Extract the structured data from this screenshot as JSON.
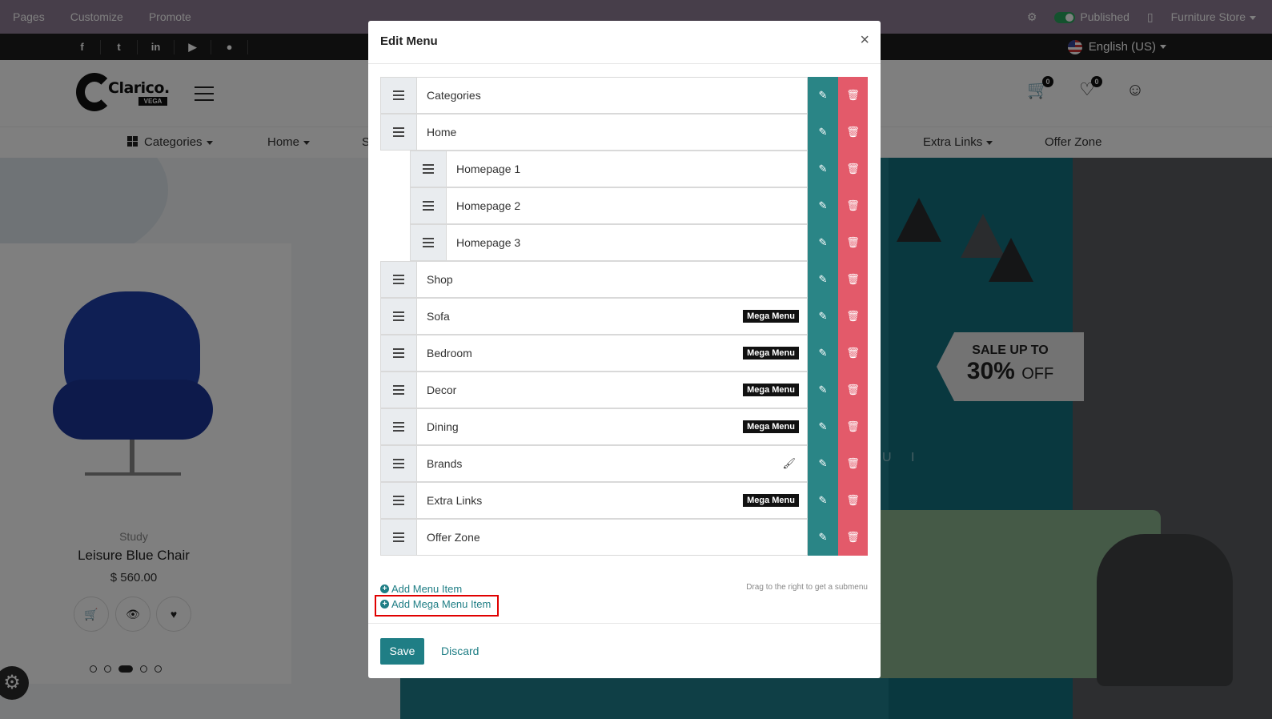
{
  "editor_bar": {
    "nav": [
      "Pages",
      "Customize",
      "Promote"
    ],
    "published_label": "Published",
    "website_label": "Furniture Store"
  },
  "social": {
    "icons": [
      "f",
      "t",
      "in",
      "▶",
      "●"
    ],
    "language": "English (US)"
  },
  "header": {
    "logo_name": "Clarico.",
    "logo_sub": "VEGA",
    "cart_count": "0",
    "wishlist_count": "0"
  },
  "nav": {
    "items": [
      "Categories",
      "Home",
      "S",
      "Extra Links",
      "Offer Zone"
    ]
  },
  "banner": {
    "sale_line1": "SALE UP TO",
    "sale_pct": "30%",
    "sale_off": "OFF",
    "letters": "U I"
  },
  "product": {
    "category": "Study",
    "name": "Leisure Blue Chair",
    "price": "$ 560.00"
  },
  "modal": {
    "title": "Edit Menu",
    "close": "×",
    "items": [
      {
        "label": "Categories",
        "level": 0,
        "badge": ""
      },
      {
        "label": "Home",
        "level": 0,
        "badge": ""
      },
      {
        "label": "Homepage 1",
        "level": 1,
        "badge": ""
      },
      {
        "label": "Homepage 2",
        "level": 1,
        "badge": ""
      },
      {
        "label": "Homepage 3",
        "level": 1,
        "badge": ""
      },
      {
        "label": "Shop",
        "level": 0,
        "badge": ""
      },
      {
        "label": "Sofa",
        "level": 0,
        "badge": "Mega Menu"
      },
      {
        "label": "Bedroom",
        "level": 0,
        "badge": "Mega Menu"
      },
      {
        "label": "Decor",
        "level": 0,
        "badge": "Mega Menu"
      },
      {
        "label": "Dining",
        "level": 0,
        "badge": "Mega Menu"
      },
      {
        "label": "Brands",
        "level": 0,
        "badge": "",
        "brush": true
      },
      {
        "label": "Extra Links",
        "level": 0,
        "badge": "Mega Menu"
      },
      {
        "label": "Offer Zone",
        "level": 0,
        "badge": ""
      }
    ],
    "add_menu_item": "Add Menu Item",
    "add_mega_menu_item": "Add Mega Menu Item",
    "hint": "Drag to the right to get a submenu",
    "save": "Save",
    "discard": "Discard"
  },
  "colors": {
    "accent": "#1f7e85",
    "edit": "#2a8586",
    "delete": "#e35a6a",
    "topbar": "#8e7c95",
    "highlight": "#e00000"
  }
}
